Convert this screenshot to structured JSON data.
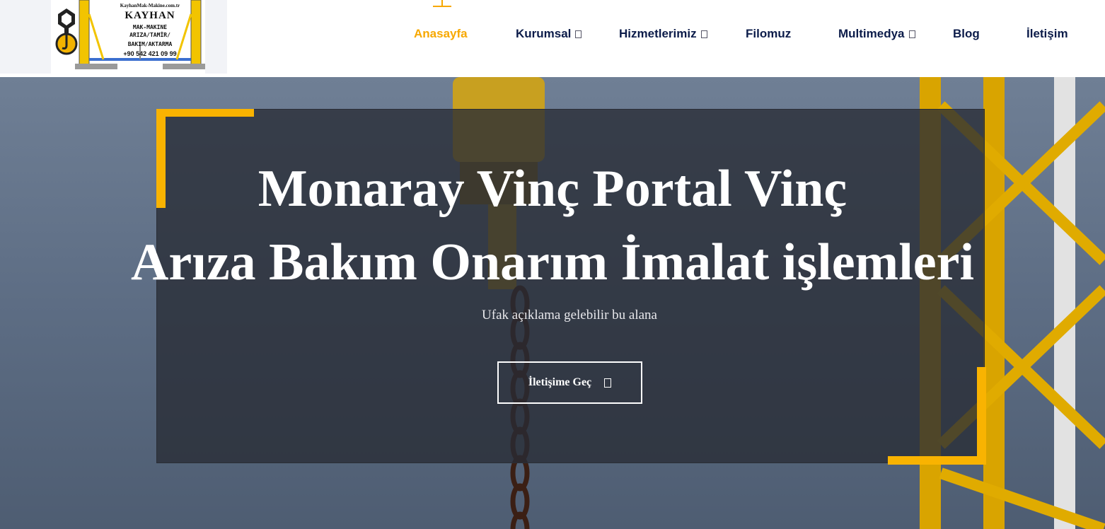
{
  "logo": {
    "url": "KayhanMak-Makine.com.tr",
    "brand": "KAYHAN",
    "line1": "MAK-MAKINE",
    "line2": "ARIZA/TAMİR/",
    "line3": "BAKIM/AKTARMA",
    "phone": "+90 542 421 09 99"
  },
  "nav": {
    "items": [
      {
        "label": "Anasayfa",
        "active": true
      },
      {
        "label": "Kurumsal",
        "dropdown": true
      },
      {
        "label": "Hizmetlerimiz",
        "dropdown": true
      },
      {
        "label": "Filomuz"
      },
      {
        "label": "Multimedya",
        "dropdown": true
      },
      {
        "label": "Blog"
      },
      {
        "label": "İletişim"
      }
    ],
    "active_color": "#f7a800",
    "text_color": "#0c1c4a",
    "caret_icon": "dropdown-caret-icon"
  },
  "hero": {
    "title_line1": "Monaray Vinç Portal Vinç",
    "title_line2": "Arıza Bakım Onarım İmalat işlemleri",
    "subtitle": "Ufak açıklama gelebilir bu alana",
    "cta_label": "İletişime Geç",
    "cta_icon": "arrow-icon",
    "accent_color": "#f9b301"
  }
}
